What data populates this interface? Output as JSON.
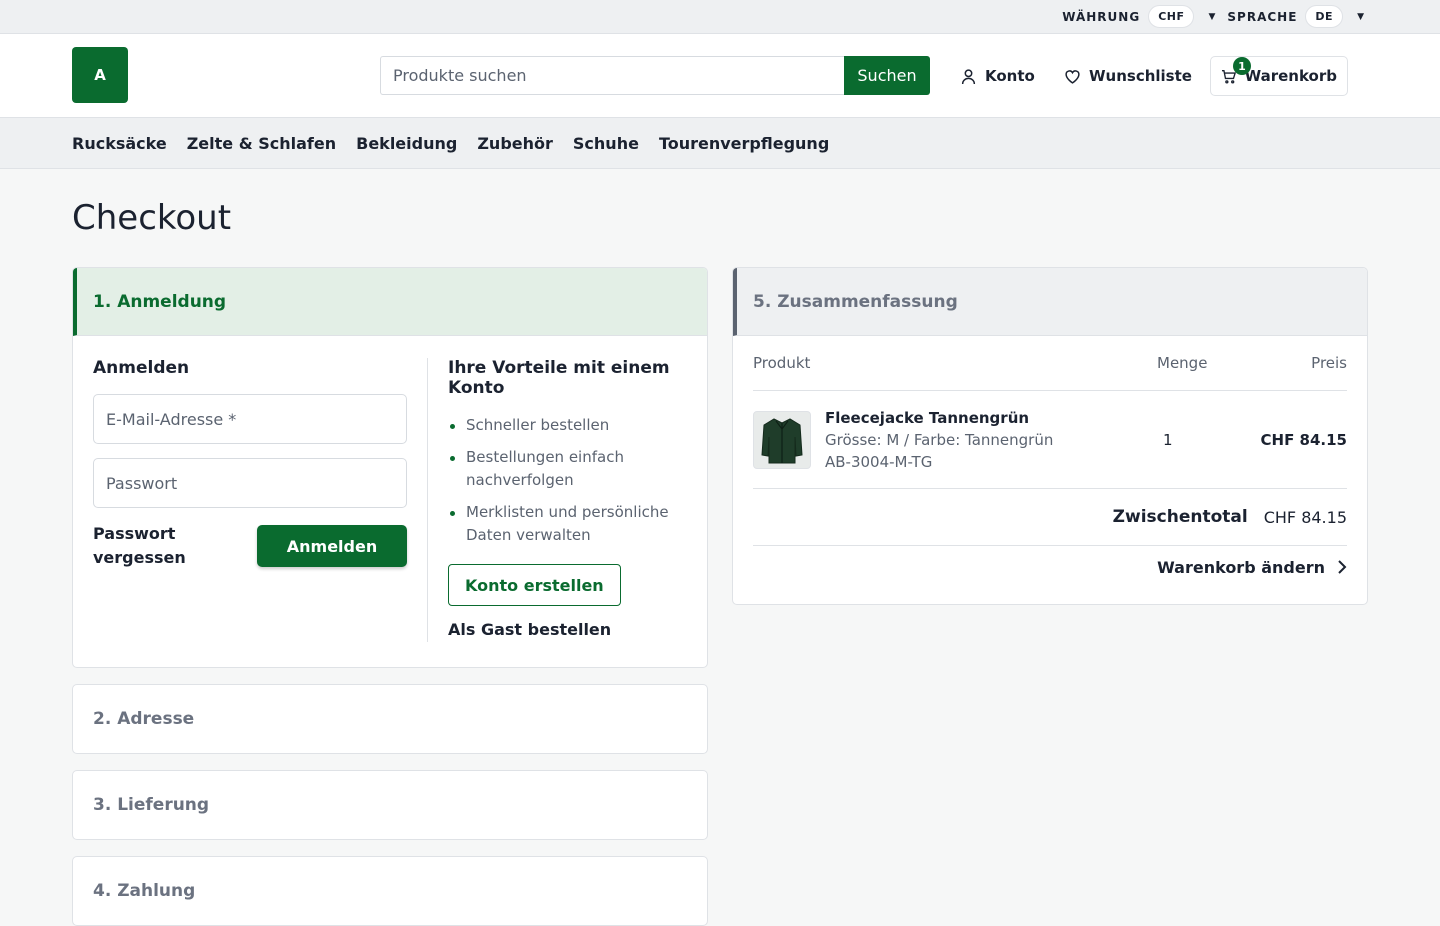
{
  "topbar": {
    "currency_label": "WÄHRUNG",
    "currency_value": "CHF",
    "language_label": "SPRACHE",
    "language_value": "DE"
  },
  "header": {
    "logo_text": "A",
    "search_placeholder": "Produkte suchen",
    "search_button": "Suchen",
    "account": "Konto",
    "wishlist": "Wunschliste",
    "cart": "Warenkorb",
    "cart_count": "1"
  },
  "nav": [
    "Rucksäcke",
    "Zelte & Schlafen",
    "Bekleidung",
    "Zubehör",
    "Schuhe",
    "Tourenverpflegung"
  ],
  "page_title": "Checkout",
  "steps": {
    "login": "1. Anmeldung",
    "address": "2. Adresse",
    "delivery": "3. Lieferung",
    "payment": "4. Zahlung",
    "summary": "5. Zusammenfassung"
  },
  "login": {
    "heading": "Anmelden",
    "email_placeholder": "E-Mail-Adresse *",
    "password_placeholder": "Passwort",
    "forgot": "Passwort vergessen",
    "submit": "Anmelden"
  },
  "benefits": {
    "heading": "Ihre Vorteile mit einem Konto",
    "items": [
      "Schneller bestellen",
      "Bestellungen einfach nachverfolgen",
      "Merklisten und persönliche Daten verwalten"
    ],
    "create_account": "Konto erstellen",
    "guest": "Als Gast bestellen"
  },
  "summary": {
    "col_product": "Produkt",
    "col_qty": "Menge",
    "col_price": "Preis",
    "item": {
      "name": "Fleecejacke Tannengrün",
      "variant": "Grösse: M / Farbe: Tannengrün",
      "sku": "AB-3004-M-TG",
      "qty": "1",
      "price": "CHF 84.15"
    },
    "subtotal_label": "Zwischentotal",
    "subtotal_value": "CHF 84.15",
    "edit_cart": "Warenkorb ändern"
  },
  "colors": {
    "brand": "#0a6b2f",
    "active_step_bg": "#e3efe6"
  }
}
